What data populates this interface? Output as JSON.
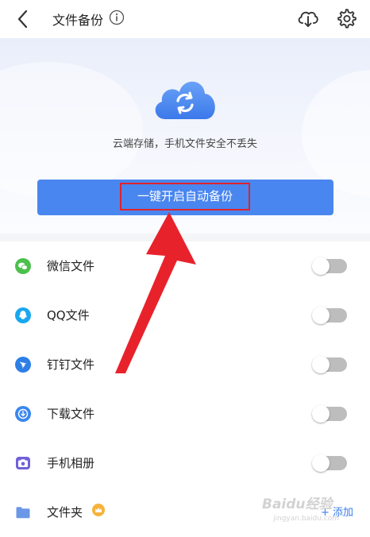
{
  "header": {
    "title": "文件备份",
    "back_icon": "chevron-left-icon",
    "info_icon": "info-icon",
    "cloud_icon": "cloud-download-icon",
    "settings_icon": "gear-icon"
  },
  "hero": {
    "subtitle": "云端存储，手机文件安全不丢失",
    "cloud_icon": "cloud-sync-icon",
    "cta_label": "一键开启自动备份"
  },
  "colors": {
    "accent": "#4a86ef",
    "highlight_border": "#e0232b",
    "annotation_arrow": "#e8222b",
    "toggle_off": "#bdbdbd"
  },
  "backup_items": [
    {
      "label": "微信文件",
      "icon": "wechat-icon",
      "enabled": false
    },
    {
      "label": "QQ文件",
      "icon": "qq-icon",
      "enabled": false
    },
    {
      "label": "钉钉文件",
      "icon": "dingtalk-icon",
      "enabled": false
    },
    {
      "label": "下载文件",
      "icon": "download-icon",
      "enabled": false
    },
    {
      "label": "手机相册",
      "icon": "camera-icon",
      "enabled": false
    },
    {
      "label": "文件夹",
      "icon": "folder-icon",
      "badge_icon": "crown-icon",
      "action_label": "+ 添加"
    }
  ],
  "watermark": {
    "text": "Baidu经验",
    "sub": "jingyan.baidu.com"
  }
}
